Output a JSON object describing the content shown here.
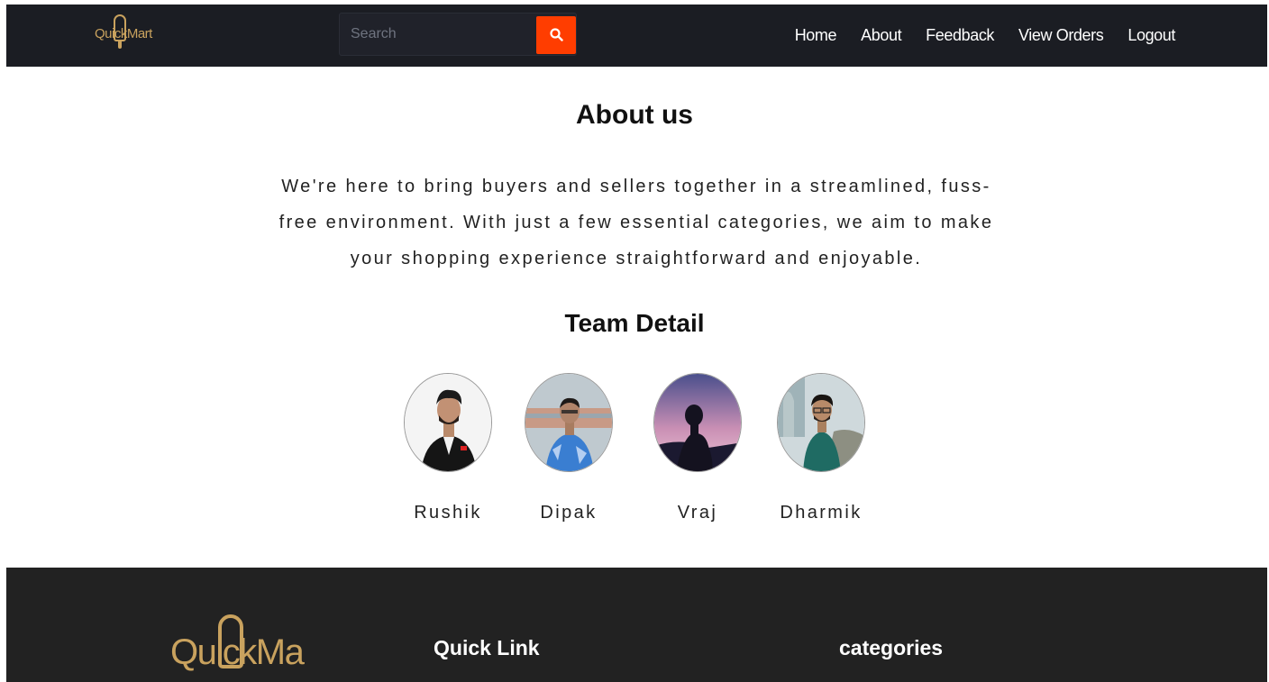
{
  "header": {
    "logo_text": "QuickMart",
    "search": {
      "placeholder": "Search"
    },
    "nav": [
      {
        "label": "Home"
      },
      {
        "label": "About"
      },
      {
        "label": "Feedback"
      },
      {
        "label": "View Orders"
      },
      {
        "label": "Logout"
      }
    ]
  },
  "about": {
    "title": "About us",
    "description": "We're here to bring buyers and sellers together in a streamlined, fuss-free environment. With just a few essential categories, we aim to make your shopping experience straightforward and enjoyable."
  },
  "team": {
    "title": "Team Detail",
    "members": [
      {
        "name": "Rushik"
      },
      {
        "name": "Dipak"
      },
      {
        "name": "Vraj"
      },
      {
        "name": "Dharmik"
      }
    ]
  },
  "footer": {
    "logo_text": "QuickMart",
    "quick_link_heading": "Quick Link",
    "categories_heading": "categories"
  },
  "colors": {
    "nav_bg": "#1b1d23",
    "accent": "#ff3d00",
    "brand_gold": "#c9a25e",
    "footer_bg": "#222222"
  }
}
